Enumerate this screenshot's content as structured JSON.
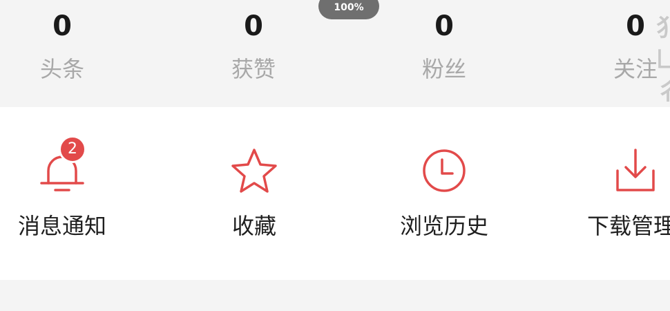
{
  "zoom": {
    "label": "100%"
  },
  "stats": [
    {
      "value": "0",
      "label": "头条"
    },
    {
      "value": "0",
      "label": "获赞"
    },
    {
      "value": "0",
      "label": "粉丝"
    },
    {
      "value": "0",
      "label": "关注"
    }
  ],
  "side_glyphs": [
    "犭",
    "凵",
    "彳"
  ],
  "tools": [
    {
      "label": "消息通知",
      "icon": "bell-icon",
      "badge": "2"
    },
    {
      "label": "收藏",
      "icon": "star-icon"
    },
    {
      "label": "浏览历史",
      "icon": "clock-icon"
    },
    {
      "label": "下载管理",
      "icon": "download-icon"
    }
  ],
  "colors": {
    "accent": "#e24a4a",
    "background": "#f4f4f4",
    "card": "#ffffff"
  }
}
